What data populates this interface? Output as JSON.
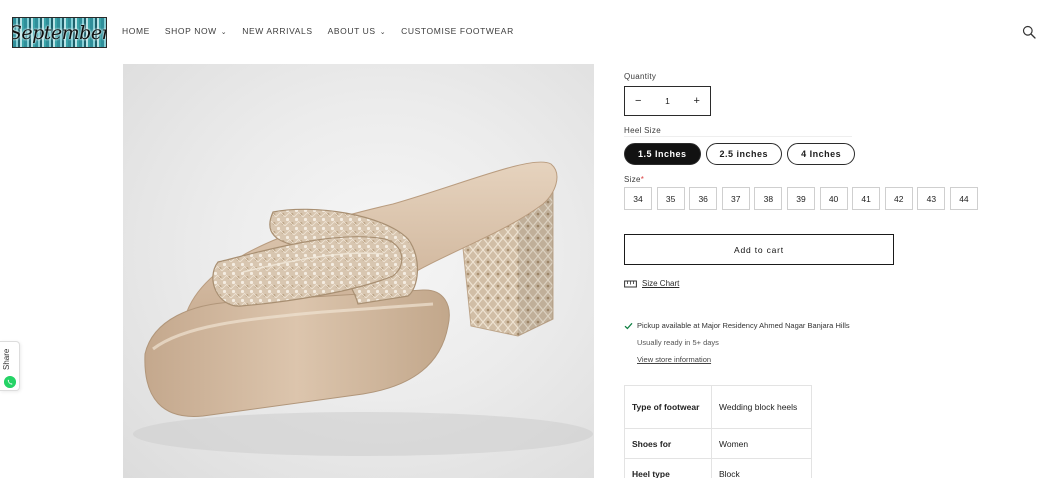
{
  "header": {
    "logo_text": "September",
    "nav": [
      {
        "label": "HOME",
        "dropdown": false
      },
      {
        "label": "SHOP NOW",
        "dropdown": true
      },
      {
        "label": "NEW ARRIVALS",
        "dropdown": false
      },
      {
        "label": "ABOUT US",
        "dropdown": true
      },
      {
        "label": "CUSTOMISE FOOTWEAR",
        "dropdown": false
      }
    ],
    "search_icon": "search-icon"
  },
  "share": {
    "label": "Share",
    "icon": "whatsapp-icon",
    "icon_color": "#25d366"
  },
  "product": {
    "image_alt": "Wedding block heels - embellished nude platform sandal",
    "quantity": {
      "label": "Quantity",
      "value": "1",
      "minus": "−",
      "plus": "+"
    },
    "heel_size": {
      "label": "Heel Size",
      "options": [
        "1.5 Inches",
        "2.5 inches",
        "4 Inches"
      ],
      "selected": "1.5 Inches"
    },
    "size": {
      "label": "Size",
      "required_mark": "*",
      "options": [
        "34",
        "35",
        "36",
        "37",
        "38",
        "39",
        "40",
        "41",
        "42",
        "43",
        "44"
      ]
    },
    "add_to_cart": "Add to cart",
    "size_chart": "Size Chart",
    "pickup": {
      "text": "Pickup available at Major Residency Ahmed Nagar Banjara Hills",
      "ready": "Usually ready in 5+ days",
      "link": "View store information",
      "check_color": "#108043"
    },
    "specs": [
      {
        "key": "Type of footwear",
        "value": "Wedding block heels"
      },
      {
        "key": "Shoes for",
        "value": "Women"
      },
      {
        "key": "Heel type",
        "value": "Block"
      }
    ]
  }
}
